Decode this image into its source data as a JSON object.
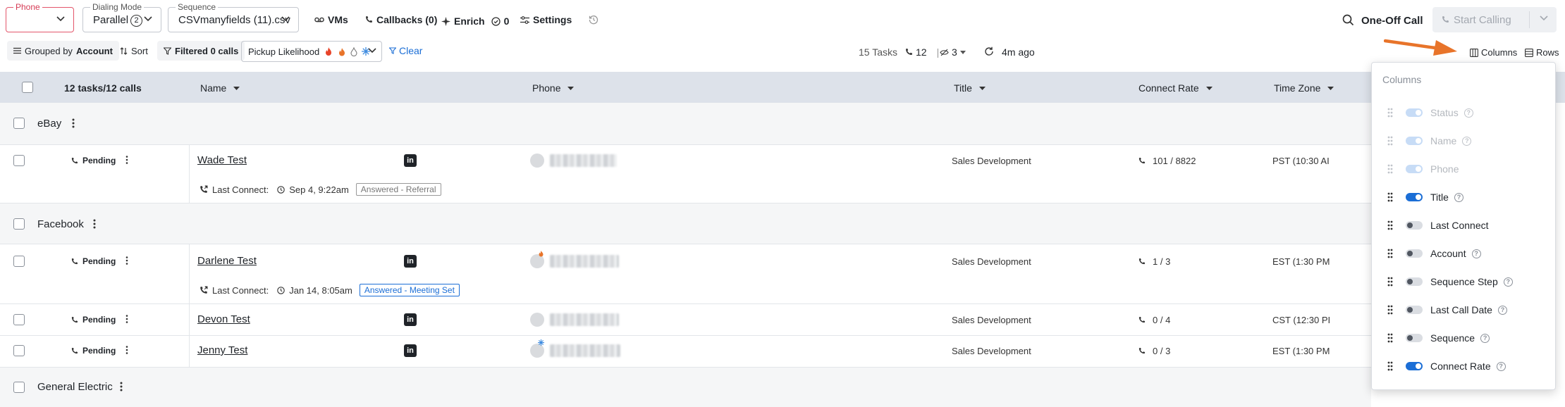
{
  "toolbar": {
    "phone_legend": "Phone",
    "dialing_mode_legend": "Dialing Mode",
    "dialing_mode_value": "Parallel",
    "dialing_mode_count": "2",
    "sequence_legend": "Sequence",
    "sequence_value": "CSVmanyfields (11).csv",
    "vms_label": "VMs",
    "callbacks_label": "Callbacks (0)",
    "enrich_label": "Enrich",
    "enrich_count": "0",
    "settings_label": "Settings",
    "one_off_call_label": "One-Off Call",
    "start_calling_label": "Start Calling"
  },
  "filters": {
    "grouped_prefix": "Grouped by",
    "grouped_value": "Account",
    "sort_label": "Sort",
    "filtered_label": "Filtered 0 calls",
    "pickup_label": "Pickup Likelihood",
    "clear_label": "Clear"
  },
  "stats": {
    "tasks": "15 Tasks",
    "calls": "12",
    "separator": "|",
    "hidden": "3",
    "updated": "4m ago"
  },
  "view": {
    "columns_label": "Columns",
    "rows_label": "Rows"
  },
  "table": {
    "header_count": "12 tasks/12 calls",
    "columns": {
      "name": "Name",
      "phone": "Phone",
      "title": "Title",
      "connect_rate": "Connect Rate",
      "time_zone": "Time Zone"
    },
    "groups": [
      {
        "name": "eBay"
      },
      {
        "name": "Facebook"
      },
      {
        "name": "General Electric"
      }
    ],
    "rows": [
      {
        "status": "Pending",
        "name": "Wade Test",
        "title": "Sales Development",
        "connect_rate": "101 / 8822",
        "time_zone": "PST (10:30 AI",
        "last_connect_label": "Last Connect:",
        "last_connect_time": "Sep 4, 9:22am",
        "tag": "Answered - Referral"
      },
      {
        "status": "Pending",
        "name": "Darlene Test",
        "title": "Sales Development",
        "connect_rate": "1 / 3",
        "time_zone": "EST (1:30 PM",
        "last_connect_label": "Last Connect:",
        "last_connect_time": "Jan 14, 8:05am",
        "tag": "Answered - Meeting Set"
      },
      {
        "status": "Pending",
        "name": "Devon Test",
        "title": "Sales Development",
        "connect_rate": "0 / 4",
        "time_zone": "CST (12:30 PI"
      },
      {
        "status": "Pending",
        "name": "Jenny Test",
        "title": "Sales Development",
        "connect_rate": "0 / 3",
        "time_zone": "EST (1:30 PM"
      }
    ]
  },
  "columns_panel": {
    "title": "Columns",
    "items": [
      {
        "label": "Status",
        "state": "disabled-on"
      },
      {
        "label": "Name",
        "state": "disabled-on"
      },
      {
        "label": "Phone",
        "state": "disabled-on"
      },
      {
        "label": "Title",
        "state": "on"
      },
      {
        "label": "Last Connect",
        "state": "off"
      },
      {
        "label": "Account",
        "state": "off"
      },
      {
        "label": "Sequence Step",
        "state": "off"
      },
      {
        "label": "Last Call Date",
        "state": "off"
      },
      {
        "label": "Sequence",
        "state": "off"
      },
      {
        "label": "Connect Rate",
        "state": "on"
      }
    ]
  },
  "colors": {
    "accent_blue": "#1b6ed6",
    "annotation_orange": "#e8742a",
    "phone_field_border": "#e3566b",
    "header_bg": "#dde2ea"
  }
}
